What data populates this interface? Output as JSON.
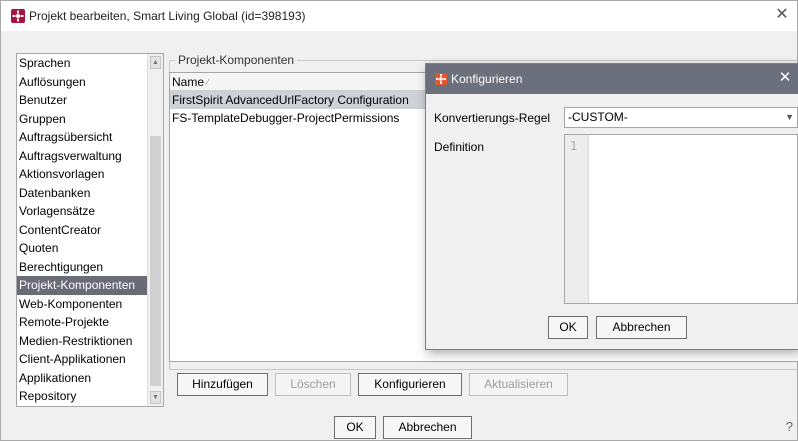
{
  "window": {
    "title": "Projekt bearbeiten, Smart Living Global (id=398193)",
    "close_glyph": "✕"
  },
  "sidebar": {
    "items": [
      {
        "label": "Sprachen"
      },
      {
        "label": "Auflösungen"
      },
      {
        "label": "Benutzer"
      },
      {
        "label": "Gruppen"
      },
      {
        "label": "Auftragsübersicht"
      },
      {
        "label": "Auftragsverwaltung"
      },
      {
        "label": "Aktionsvorlagen"
      },
      {
        "label": "Datenbanken"
      },
      {
        "label": "Vorlagensätze"
      },
      {
        "label": "ContentCreator"
      },
      {
        "label": "Quoten"
      },
      {
        "label": "Berechtigungen"
      },
      {
        "label": "Projekt-Komponenten"
      },
      {
        "label": "Web-Komponenten"
      },
      {
        "label": "Remote-Projekte"
      },
      {
        "label": "Medien-Restriktionen"
      },
      {
        "label": "Client-Applikationen"
      },
      {
        "label": "Applikationen"
      },
      {
        "label": "Repository"
      }
    ],
    "selected": "Projekt-Komponenten"
  },
  "components": {
    "group_title": "Projekt-Komponenten",
    "column_header": "Name",
    "rows": [
      {
        "name": "FirstSpirit AdvancedUrlFactory Configuration"
      },
      {
        "name": "FS-TemplateDebugger-ProjectPermissions"
      }
    ],
    "buttons": {
      "add": "Hinzufügen",
      "delete": "Löschen",
      "configure": "Konfigurieren",
      "refresh": "Aktualisieren"
    }
  },
  "footer": {
    "ok": "OK",
    "cancel": "Abbrechen",
    "help": "?"
  },
  "modal": {
    "title": "Konfigurieren",
    "close_glyph": "✕",
    "rule_label": "Konvertierungs-Regel",
    "rule_value": "-CUSTOM-",
    "definition_label": "Definition",
    "line_number": "1",
    "ok": "OK",
    "cancel": "Abbrechen"
  },
  "colors": {
    "accent": "#a8123e",
    "selection": "#696b76",
    "modal_titlebar": "#6c6f7c"
  }
}
